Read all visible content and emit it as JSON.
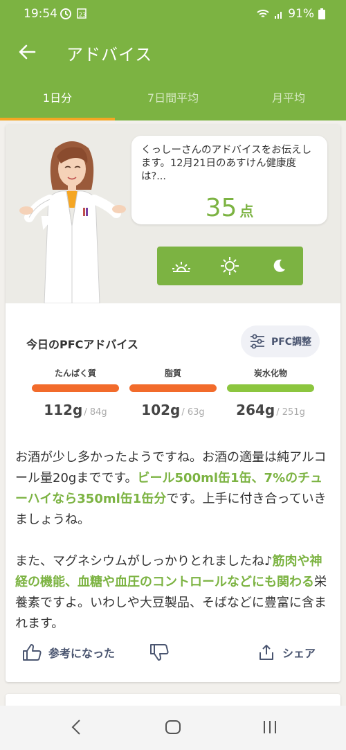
{
  "status_bar": {
    "time": "19:54",
    "battery": "91%",
    "icons": [
      "alarm-clock-icon",
      "calendar-icon",
      "wifi-icon",
      "signal-icon",
      "battery-icon"
    ]
  },
  "app_bar": {
    "title": "アドバイス",
    "back_icon": "arrow-left-icon"
  },
  "tabs": [
    {
      "label": "1日分",
      "active": true
    },
    {
      "label": "7日間平均",
      "active": false
    },
    {
      "label": "月平均",
      "active": false
    }
  ],
  "advice_bubble": {
    "message": "くっしーさんのアドバイスをお伝えします。12月21日のあすけん健康度は?...",
    "score": "35",
    "score_unit": "点"
  },
  "time_of_day": [
    "sunrise-icon",
    "sun-icon",
    "moon-icon"
  ],
  "pfc": {
    "title": "今日のPFCアドバイス",
    "adjust_button": "PFC調整",
    "items": [
      {
        "label": "たんぱく質",
        "value": "112",
        "unit": "g",
        "target": "/ 84g",
        "color": "#f26b2b"
      },
      {
        "label": "脂質",
        "value": "102",
        "unit": "g",
        "target": "/ 63g",
        "color": "#f26b2b"
      },
      {
        "label": "炭水化物",
        "value": "264",
        "unit": "g",
        "target": "/ 251g",
        "color": "#8cc63f"
      }
    ]
  },
  "advice_text": {
    "p1_a": "お酒が少し多かったようですね。お酒の適量は純アルコール量20gまでです。",
    "p1_hl": "ビール500ml缶1缶、7%のチューハイなら350ml缶1缶分",
    "p1_b": "です。上手に付き合っていきましょうね。",
    "p2_a": "また、マグネシウムがしっかりとれましたね♪",
    "p2_hl": "筋肉や神経の機能、血糖や血圧のコントロールなどにも関わる",
    "p2_b": "栄養素ですよ。いわしや大豆製品、そばなどに豊富に含まれます。"
  },
  "actions": {
    "helpful": "参考になった",
    "share": "シェア"
  },
  "colors": {
    "brand_green": "#7cb342",
    "accent_orange": "#f5a623",
    "warning_orange": "#f26b2b"
  }
}
